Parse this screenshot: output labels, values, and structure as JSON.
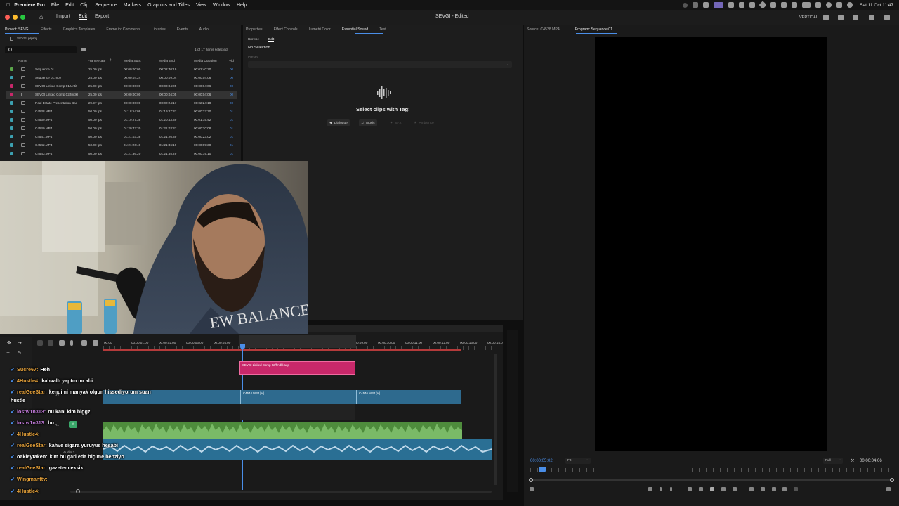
{
  "menubar": {
    "app": "Premiere Pro",
    "items": [
      "File",
      "Edit",
      "Clip",
      "Sequence",
      "Markers",
      "Graphics and Titles",
      "View",
      "Window",
      "Help"
    ],
    "clock": "Sat 11 Oct  11:47"
  },
  "titlebar": {
    "import": "Import",
    "edit": "Edit",
    "export": "Export",
    "doc_title": "SEVGI - Edited",
    "workspace": "VERTICAL"
  },
  "project_panel": {
    "tabs": [
      "Project: SEVGI",
      "Effects",
      "Graphics Templates",
      "Frame.io: Comments",
      "Libraries",
      "Events",
      "Audio"
    ],
    "file": "SEVGI.prproj",
    "items_selected": "1 of 17 items selected",
    "columns": [
      "Name",
      "Frame Rate",
      "Media Start",
      "Media End",
      "Media Duration",
      "Vid"
    ],
    "rows": [
      {
        "name": "Sequence 01",
        "rate": "25.00 fps",
        "start": "00:00:00:00",
        "end": "00:02:40:19",
        "dur": "00:02:40:20",
        "vid": "00",
        "color": "#5aa64a"
      },
      {
        "name": "Sequence 01.mov",
        "rate": "25.00 fps",
        "start": "00:00:04:24",
        "end": "00:00:09:04",
        "dur": "00:00:04:06",
        "vid": "00",
        "color": "#3ca0b0"
      },
      {
        "name": "SEVGI Linked Comp 01/Untit",
        "rate": "25.00 fps",
        "start": "00:00:00:00",
        "end": "00:00:04:05",
        "dur": "00:00:04:06",
        "vid": "00",
        "color": "#c8286a"
      },
      {
        "name": "SEVGI Linked Comp 02/fmdkl",
        "rate": "25.00 fps",
        "start": "00:00:00:00",
        "end": "00:00:04:05",
        "dur": "00:00:04:06",
        "vid": "00",
        "color": "#c8286a"
      },
      {
        "name": "Real Estate Presentation Bac",
        "rate": "29.97 fps",
        "start": "00:00:00:00",
        "end": "00:02:24:17",
        "dur": "00:02:24:18",
        "vid": "00",
        "color": "#3ca0b0"
      },
      {
        "name": "C4538.MP4",
        "rate": "50.00 fps",
        "start": "01:18:54:08",
        "end": "01:19:27:37",
        "dur": "00:00:33:30",
        "vid": "01",
        "color": "#3ca0b0"
      },
      {
        "name": "C4539.MP4",
        "rate": "50.00 fps",
        "start": "01:19:27:38",
        "end": "01:20:43:39",
        "dur": "00:01:15:42",
        "vid": "01",
        "color": "#3ca0b0"
      },
      {
        "name": "C4540.MP4",
        "rate": "50.00 fps",
        "start": "01:20:43:30",
        "end": "01:21:03:37",
        "dur": "00:00:20:08",
        "vid": "01",
        "color": "#3ca0b0"
      },
      {
        "name": "C4541.MP4",
        "rate": "50.00 fps",
        "start": "01:21:03:38",
        "end": "01:21:26:39",
        "dur": "00:00:23:02",
        "vid": "01",
        "color": "#3ca0b0"
      },
      {
        "name": "C4542.MP4",
        "rate": "50.00 fps",
        "start": "01:21:26:40",
        "end": "01:21:36:19",
        "dur": "00:00:09:30",
        "vid": "01",
        "color": "#3ca0b0"
      },
      {
        "name": "C4543.MP4",
        "rate": "50.00 fps",
        "start": "01:21:36:20",
        "end": "01:21:55:29",
        "dur": "00:00:19:10",
        "vid": "01",
        "color": "#3ca0b0"
      }
    ]
  },
  "essential_sound": {
    "tabs": [
      "Properties",
      "Effect Controls",
      "Lumetri Color",
      "Essential Sound",
      "Text"
    ],
    "subtabs": [
      "Browse",
      "Edit"
    ],
    "no_selection": "No Selection",
    "preset_label": "Preset",
    "prompt": "Select clips with Tag:",
    "tags": [
      "Dialogue",
      "Music",
      "SFX",
      "Ambience"
    ]
  },
  "monitor": {
    "source_tab": "Source: C4538.MP4",
    "program_tab": "Program: Sequence 01",
    "timecode": "00:00:05:02",
    "fit": "Fit",
    "quality": "Full",
    "duration": "00:00:04:06"
  },
  "timeline": {
    "ruler": [
      "00:00",
      "00:00:01:00",
      "00:00:02:00",
      "00:00:03:00",
      "00:00:04:00",
      "00:00:05:00",
      "00:00:06:00",
      "00:00:07:00",
      "00:00:08:00",
      "00:00:09:00",
      "00:00:10:00",
      "00:00:11:00",
      "00:00:12:00",
      "00:00:13:00",
      "00:00:14:0"
    ],
    "clip_v3": "SEVGI Linked Comp 02/fmdkl.aep",
    "clip_v1a": "C4544.MP4 [V]",
    "clip_v1b": "C4546.MP4 [V]",
    "track_labels": [
      "V2",
      "A1",
      "Audio 3"
    ]
  },
  "chat": [
    {
      "user": "Sucre67:",
      "msg": "Heh",
      "color": "#e8a33a"
    },
    {
      "user": "4Hustle4:",
      "msg": "kahvaltı yaptın mı abi",
      "color": "#e8a33a"
    },
    {
      "user": "realGeeStar:",
      "msg": "kendimi manyak olgun hissediyorum suan",
      "color": "#e8a33a"
    },
    {
      "user": "",
      "msg": "hustle",
      "color": "#ffffff"
    },
    {
      "user": "lostw1n313:",
      "msg": "nu kanı kim biggz",
      "color": "#c07ad8"
    },
    {
      "user": "lostw1n313:",
      "msg": "bu",
      "color": "#c07ad8"
    },
    {
      "user": "4Hustle4:",
      "msg": "",
      "color": "#e8a33a"
    },
    {
      "user": "realGeeStar:",
      "msg": "kahve sigara yuruyus hesabi",
      "color": "#e8a33a"
    },
    {
      "user": "oakleytaken:",
      "msg": "kim bu gari eda biçime benziyo",
      "color": "#ffffff"
    },
    {
      "user": "realGeeStar:",
      "msg": "gazetem eksik",
      "color": "#e8a33a"
    },
    {
      "user": "Wingmanttv:",
      "msg": "",
      "color": "#e8a33a"
    },
    {
      "user": "4Hustle4:",
      "msg": "",
      "color": "#e8a33a"
    }
  ],
  "colors": {
    "accent_blue": "#4a8ee8",
    "clip_pink": "#c8286a",
    "clip_blue": "#2e6a8e",
    "audio_green": "#5aa64a"
  }
}
